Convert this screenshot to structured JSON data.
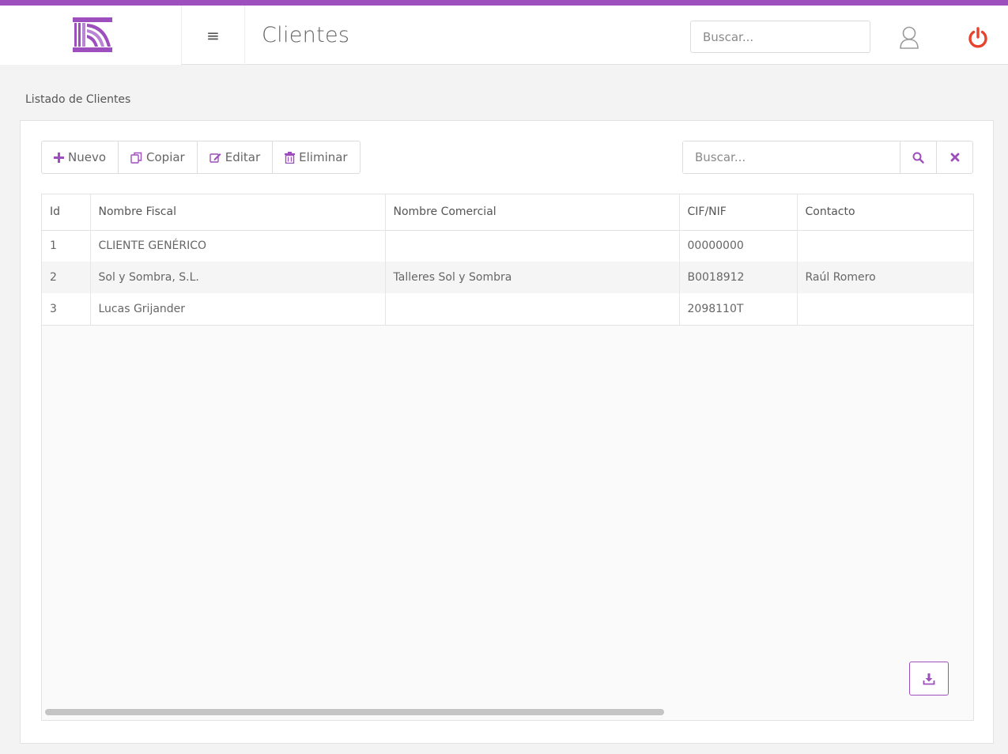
{
  "app": {
    "title": "Clientes",
    "brand_color": "#9c4fbd",
    "power_color": "#e8412c",
    "menu_glyph": "≡",
    "search_placeholder": "Buscar..."
  },
  "section": {
    "label": "Listado de Clientes"
  },
  "toolbar": {
    "buttons": [
      {
        "label": "Nuevo",
        "icon": "plus-icon"
      },
      {
        "label": "Copiar",
        "icon": "copy-icon"
      },
      {
        "label": "Editar",
        "icon": "edit-icon"
      },
      {
        "label": "Eliminar",
        "icon": "trash-icon"
      }
    ],
    "search_placeholder": "Buscar..."
  },
  "table": {
    "columns": [
      "Id",
      "Nombre Fiscal",
      "Nombre Comercial",
      "CIF/NIF",
      "Contacto"
    ],
    "rows": [
      [
        "1",
        "CLIENTE GENÉRICO",
        "",
        "00000000",
        ""
      ],
      [
        "2",
        "Sol y Sombra, S.L.",
        "Talleres Sol y Sombra",
        "B0018912",
        "Raúl Romero"
      ],
      [
        "3",
        "Lucas Grijander",
        "",
        "2098110T",
        ""
      ]
    ]
  }
}
